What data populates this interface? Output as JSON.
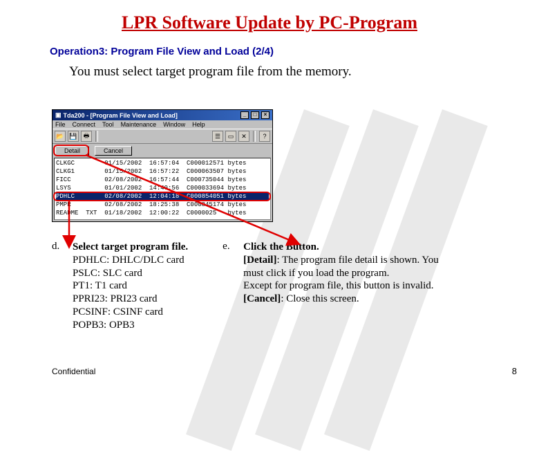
{
  "title": "LPR Software Update by PC-Program",
  "subtitle": "Operation3: Program File View and Load (2/4)",
  "instruction": "You must select target program file from the memory.",
  "window": {
    "title": "Tda200 - [Program File View and Load]",
    "menu": [
      "File",
      "Connect",
      "Tool",
      "Maintenance",
      "Window",
      "Help"
    ],
    "buttons": {
      "detail": "Detail",
      "cancel": "Cancel"
    },
    "rows": [
      "CLKGC        01/15/2002  16:57:04  C000012571 bytes",
      "CLKG1        01/15/2002  16:57:22  C000063507 bytes",
      "FICC         02/08/2002  16:57:44  C000735044 bytes",
      "LSYS         01/01/2002  14:49:56  C000033694 bytes",
      "PDHLC        02/08/2002  12:04:18  C000854051 bytes",
      "PMPR         02/08/2002  18:25:38  C000845174 bytes",
      "README  TXT  01/18/2002  12:00:22  C0000025   bytes"
    ],
    "selected_index": 4
  },
  "steps": {
    "d": {
      "marker": "d.",
      "heading": "Select target program file.",
      "lines": [
        "PDHLC: DHLC/DLC card",
        "PSLC: SLC card",
        "PT1: T1 card",
        "PPRI23: PRI23 card",
        "PCSINF: CSINF card",
        "POPB3: OPB3"
      ]
    },
    "e": {
      "marker": "e.",
      "heading": "Click the Button.",
      "detail_label": "[Detail]",
      "detail_text": ": The program file detail is shown. You must click if you load the program.",
      "extra": "Except for program file, this button is invalid.",
      "cancel_label": "[Cancel]",
      "cancel_text": ": Close this screen."
    }
  },
  "footer": {
    "confidential": "Confidential",
    "page": "8"
  }
}
